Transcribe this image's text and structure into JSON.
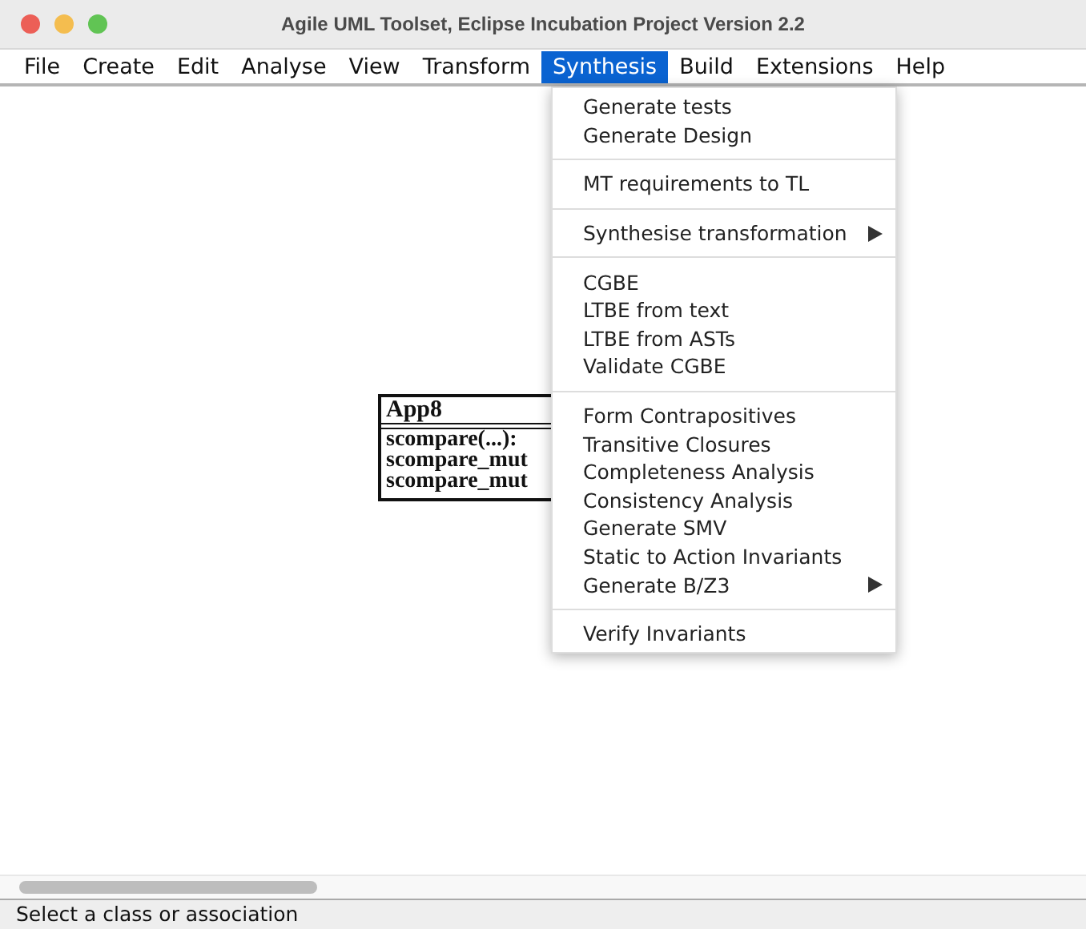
{
  "window": {
    "title": "Agile UML Toolset, Eclipse Incubation Project Version 2.2"
  },
  "menubar": [
    {
      "label": "File",
      "selected": false
    },
    {
      "label": "Create",
      "selected": false
    },
    {
      "label": "Edit",
      "selected": false
    },
    {
      "label": "Analyse",
      "selected": false
    },
    {
      "label": "View",
      "selected": false
    },
    {
      "label": "Transform",
      "selected": false
    },
    {
      "label": "Synthesis",
      "selected": true
    },
    {
      "label": "Build",
      "selected": false
    },
    {
      "label": "Extensions",
      "selected": false
    },
    {
      "label": "Help",
      "selected": false
    }
  ],
  "menu": {
    "groups": [
      [
        {
          "label": "Generate tests",
          "submenu": false
        },
        {
          "label": "Generate Design",
          "submenu": false
        }
      ],
      [
        {
          "label": "MT requirements to TL",
          "submenu": false
        }
      ],
      [
        {
          "label": "Synthesise transformation",
          "submenu": true
        }
      ],
      [
        {
          "label": "CGBE",
          "submenu": false
        },
        {
          "label": "LTBE from text",
          "submenu": false
        },
        {
          "label": "LTBE from ASTs",
          "submenu": false
        },
        {
          "label": "Validate CGBE",
          "submenu": false
        }
      ],
      [
        {
          "label": "Form Contrapositives",
          "submenu": false
        },
        {
          "label": "Transitive Closures",
          "submenu": false
        },
        {
          "label": "Completeness Analysis",
          "submenu": false
        },
        {
          "label": "Consistency Analysis",
          "submenu": false
        },
        {
          "label": "Generate SMV",
          "submenu": false
        },
        {
          "label": "Static to Action Invariants",
          "submenu": false
        },
        {
          "label": "Generate B/Z3",
          "submenu": true
        }
      ],
      [
        {
          "label": "Verify Invariants",
          "submenu": false
        }
      ]
    ]
  },
  "class_box": {
    "name": "App8",
    "operations": [
      "scompare(...):",
      "scompare_mut",
      "scompare_mut"
    ]
  },
  "status_bar": "Select a class or association"
}
